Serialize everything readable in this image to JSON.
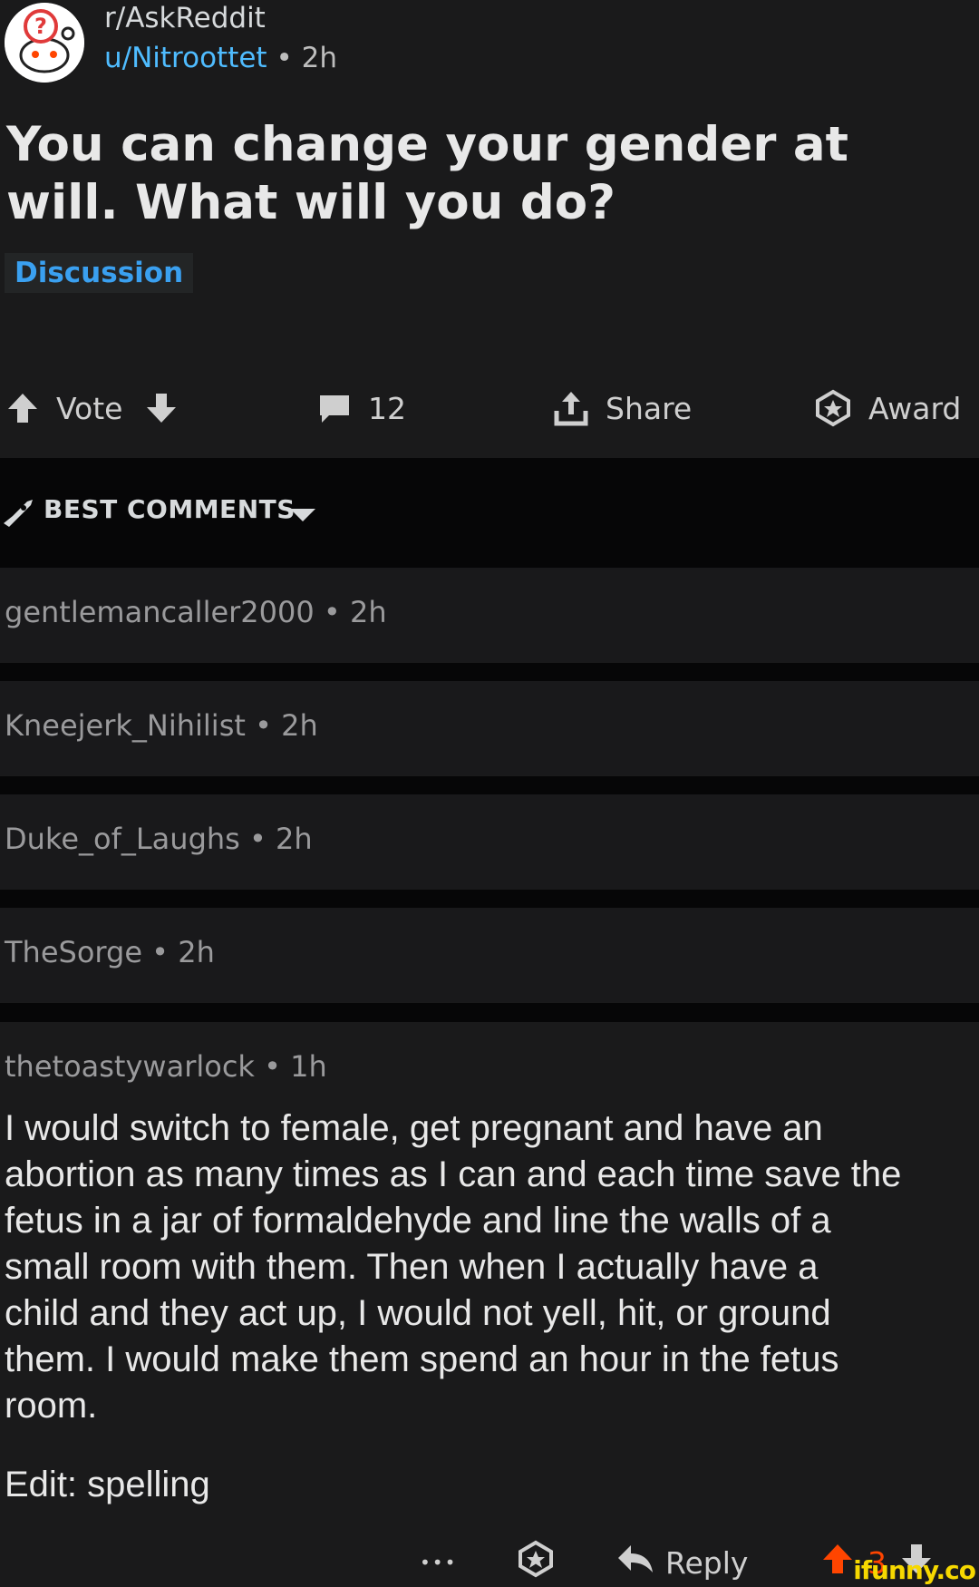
{
  "post": {
    "subreddit": "r/AskReddit",
    "author": "u/Nitroottet",
    "separator": "•",
    "time": "2h",
    "title": "You can change your gender at will. What will you do?",
    "flair": "Discussion"
  },
  "actions": {
    "vote_label": "Vote",
    "comment_count": "12",
    "share_label": "Share",
    "award_label": "Award"
  },
  "sort": {
    "label": "BEST COMMENTS"
  },
  "comments": [
    {
      "author": "gentlemancaller2000",
      "time": "2h"
    },
    {
      "author": "Kneejerk_Nihilist",
      "time": "2h"
    },
    {
      "author": "Duke_of_Laughs",
      "time": "2h"
    },
    {
      "author": "TheSorge",
      "time": "2h"
    }
  ],
  "featured_comment": {
    "author": "thetoastywarlock",
    "time": "1h",
    "lines": [
      "I would switch to female, get pregnant and have an",
      "abortion as many times as I can and each time save the",
      "fetus in a jar of formaldehyde and line the walls of a",
      "small room with them. Then when I actually have a",
      "child and they act up, I would not yell, hit, or ground",
      "them. I would make them spend an hour in the fetus",
      "room."
    ],
    "edit": "Edit: spelling",
    "more_label": "•••",
    "reply_label": "Reply",
    "score": "3"
  },
  "watermark": "ifunny.co",
  "colors": {
    "background": "#1a1a1b",
    "divider": "#060607",
    "username_link": "#4fbcff",
    "flair_text": "#3aa0f0",
    "upvote": "#ff4500",
    "watermark": "#f6d800"
  }
}
